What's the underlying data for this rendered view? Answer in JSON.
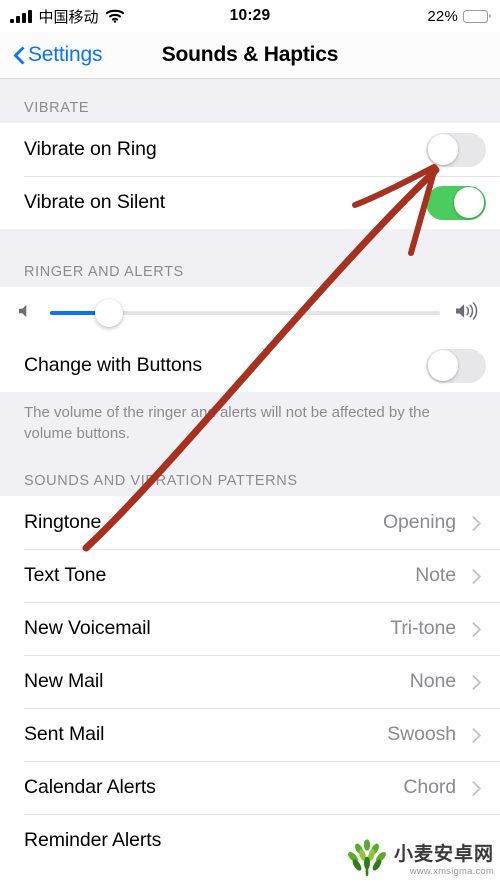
{
  "status_bar": {
    "carrier": "中国移动",
    "signal_icon": "signal-bars-icon",
    "wifi_icon": "wifi-icon",
    "time": "10:29",
    "battery_percent": "22%",
    "battery_level": 22,
    "battery_color": "#f8c82e"
  },
  "nav": {
    "back_label": "Settings",
    "back_icon": "chevron-left-icon",
    "title": "Sounds & Haptics",
    "accent_color": "#0b74ef"
  },
  "sections": {
    "vibrate": {
      "header": "VIBRATE",
      "rows": [
        {
          "label": "Vibrate on Ring",
          "toggle": "off"
        },
        {
          "label": "Vibrate on Silent",
          "toggle": "on"
        }
      ]
    },
    "ringer": {
      "header": "RINGER AND ALERTS",
      "slider": {
        "value_percent": 15,
        "left_icon": "speaker-low-icon",
        "right_icon": "speaker-high-icon",
        "fill_color": "#0b74ef"
      },
      "change_with_buttons": {
        "label": "Change with Buttons",
        "toggle": "off"
      },
      "footer": "The volume of the ringer and alerts will not be affected by the volume buttons."
    },
    "sounds": {
      "header": "SOUNDS AND VIBRATION PATTERNS",
      "rows": [
        {
          "label": "Ringtone",
          "value": "Opening"
        },
        {
          "label": "Text Tone",
          "value": "Note"
        },
        {
          "label": "New Voicemail",
          "value": "Tri-tone"
        },
        {
          "label": "New Mail",
          "value": "None"
        },
        {
          "label": "Sent Mail",
          "value": "Swoosh"
        },
        {
          "label": "Calendar Alerts",
          "value": "Chord"
        },
        {
          "label": "Reminder Alerts",
          "value": ""
        }
      ]
    }
  },
  "annotation": {
    "type": "arrow",
    "color": "#a8301f",
    "points_to": "Vibrate on Ring toggle"
  },
  "watermark": {
    "title": "小麦安卓网",
    "url": "www.xmsigma.com",
    "logo_icon": "wheat-leaf-logo-icon",
    "logo_color": "#5aaa2e"
  },
  "toggle_colors": {
    "on": "#4ccb5f",
    "off": "#e7e7ea"
  }
}
